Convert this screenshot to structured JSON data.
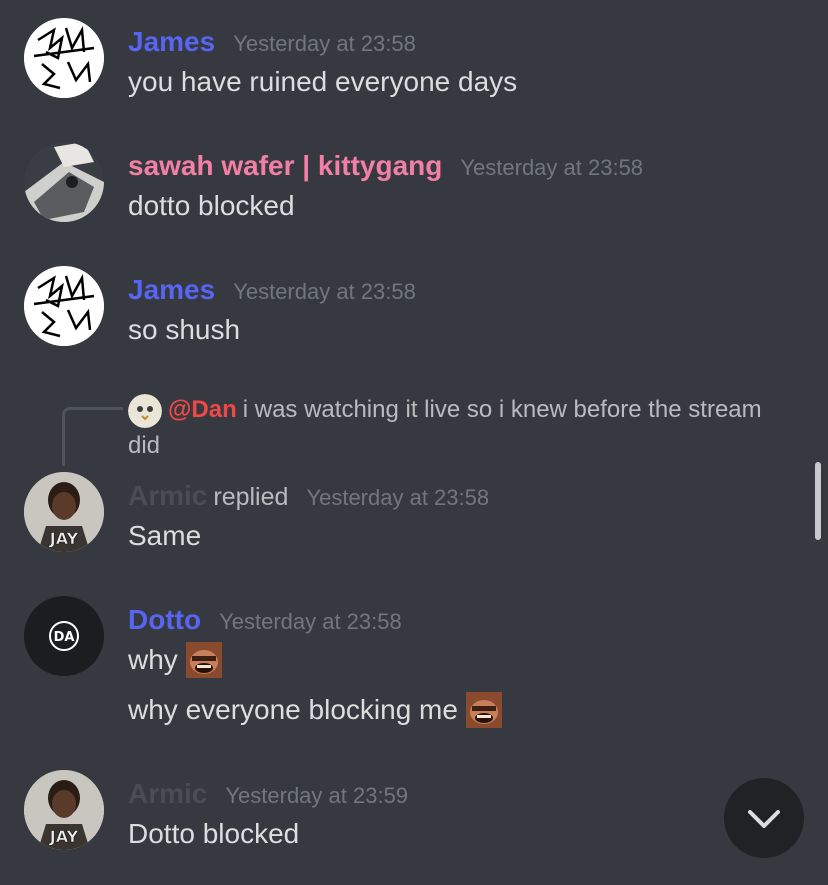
{
  "messages": [
    {
      "author": "James",
      "author_color": "#5865f2",
      "time": "Yesterday at 23:58",
      "lines": [
        "you have ruined everyone days"
      ]
    },
    {
      "author": "sawah wafer | kittygang",
      "author_color": "#f47fa4",
      "time": "Yesterday at 23:58",
      "lines": [
        "dotto blocked"
      ]
    },
    {
      "author": "James",
      "author_color": "#5865f2",
      "time": "Yesterday at 23:58",
      "lines": [
        "so shush"
      ]
    },
    {
      "author": "Armic",
      "author_color": "#4a4d53",
      "replied_label": "replied",
      "time": "Yesterday at 23:58",
      "lines": [
        "Same"
      ],
      "reply": {
        "mention": "@Dan",
        "text": "i was watching it live so i knew before the stream did"
      }
    },
    {
      "author": "Dotto",
      "author_color": "#5865f2",
      "time": "Yesterday at 23:58",
      "lines": [
        "why",
        "why everyone blocking me"
      ],
      "avatar_text": "DA"
    },
    {
      "author": "Armic",
      "author_color": "#4a4d53",
      "time": "Yesterday at 23:59",
      "lines": [
        "Dotto blocked"
      ]
    }
  ],
  "icons": {
    "emoji": "laughing-face-emoji",
    "jump": "chevron-down-icon"
  }
}
